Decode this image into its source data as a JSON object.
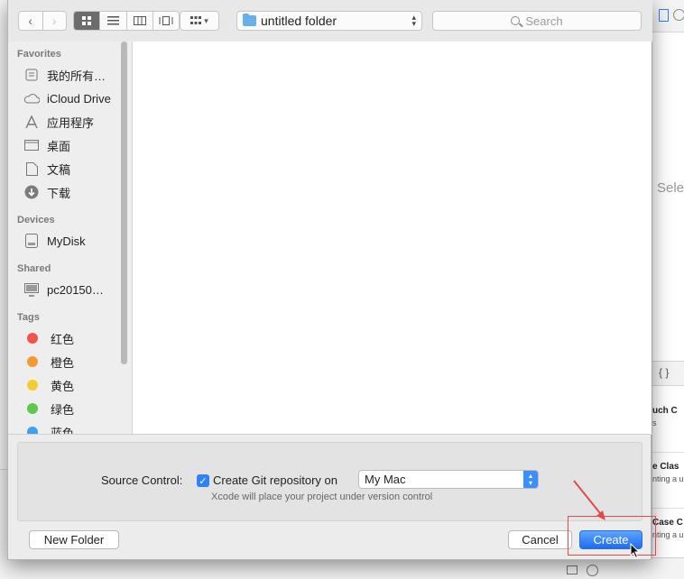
{
  "toolbar": {
    "back_icon": "chevron-left-icon",
    "forward_icon": "chevron-right-icon",
    "view_modes": [
      "icon-view",
      "list-view",
      "column-view",
      "cover-flow-view"
    ],
    "location": "untitled folder",
    "search_placeholder": "Search"
  },
  "sidebar": {
    "sections": {
      "favorites": "Favorites",
      "devices": "Devices",
      "shared": "Shared",
      "tags": "Tags"
    },
    "favorites": [
      {
        "label": "我的所有…",
        "icon": "all-files-icon"
      },
      {
        "label": "iCloud Drive",
        "icon": "cloud-icon"
      },
      {
        "label": "应用程序",
        "icon": "applications-icon"
      },
      {
        "label": "桌面",
        "icon": "desktop-icon"
      },
      {
        "label": "文稿",
        "icon": "documents-icon"
      },
      {
        "label": "下载",
        "icon": "downloads-icon"
      }
    ],
    "devices": [
      {
        "label": "MyDisk",
        "icon": "disk-icon"
      }
    ],
    "shared": [
      {
        "label": "pc20150…",
        "icon": "computer-icon"
      }
    ],
    "tags": [
      {
        "label": "红色",
        "color": "#f0544a"
      },
      {
        "label": "橙色",
        "color": "#f59a32"
      },
      {
        "label": "黄色",
        "color": "#f4cc2f"
      },
      {
        "label": "绿色",
        "color": "#5bc94b"
      },
      {
        "label": "蓝色",
        "color": "#3e9ff5"
      }
    ]
  },
  "options": {
    "source_control_label": "Source Control:",
    "git_checked": true,
    "git_label": "Create Git repository on",
    "git_target": "My Mac",
    "hint": "Xcode will place your project under version control"
  },
  "buttons": {
    "new_folder": "New Folder",
    "cancel": "Cancel",
    "create": "Create"
  },
  "background": {
    "selection_text": "Sele",
    "templates": [
      {
        "title": "uch C",
        "sub": "s"
      },
      {
        "title": "e Clas",
        "sub": "nting a u"
      },
      {
        "title": "Case C",
        "sub": "nting a u"
      }
    ]
  },
  "colors": {
    "accent": "#2f82f7",
    "annotation": "#e14a4a"
  }
}
